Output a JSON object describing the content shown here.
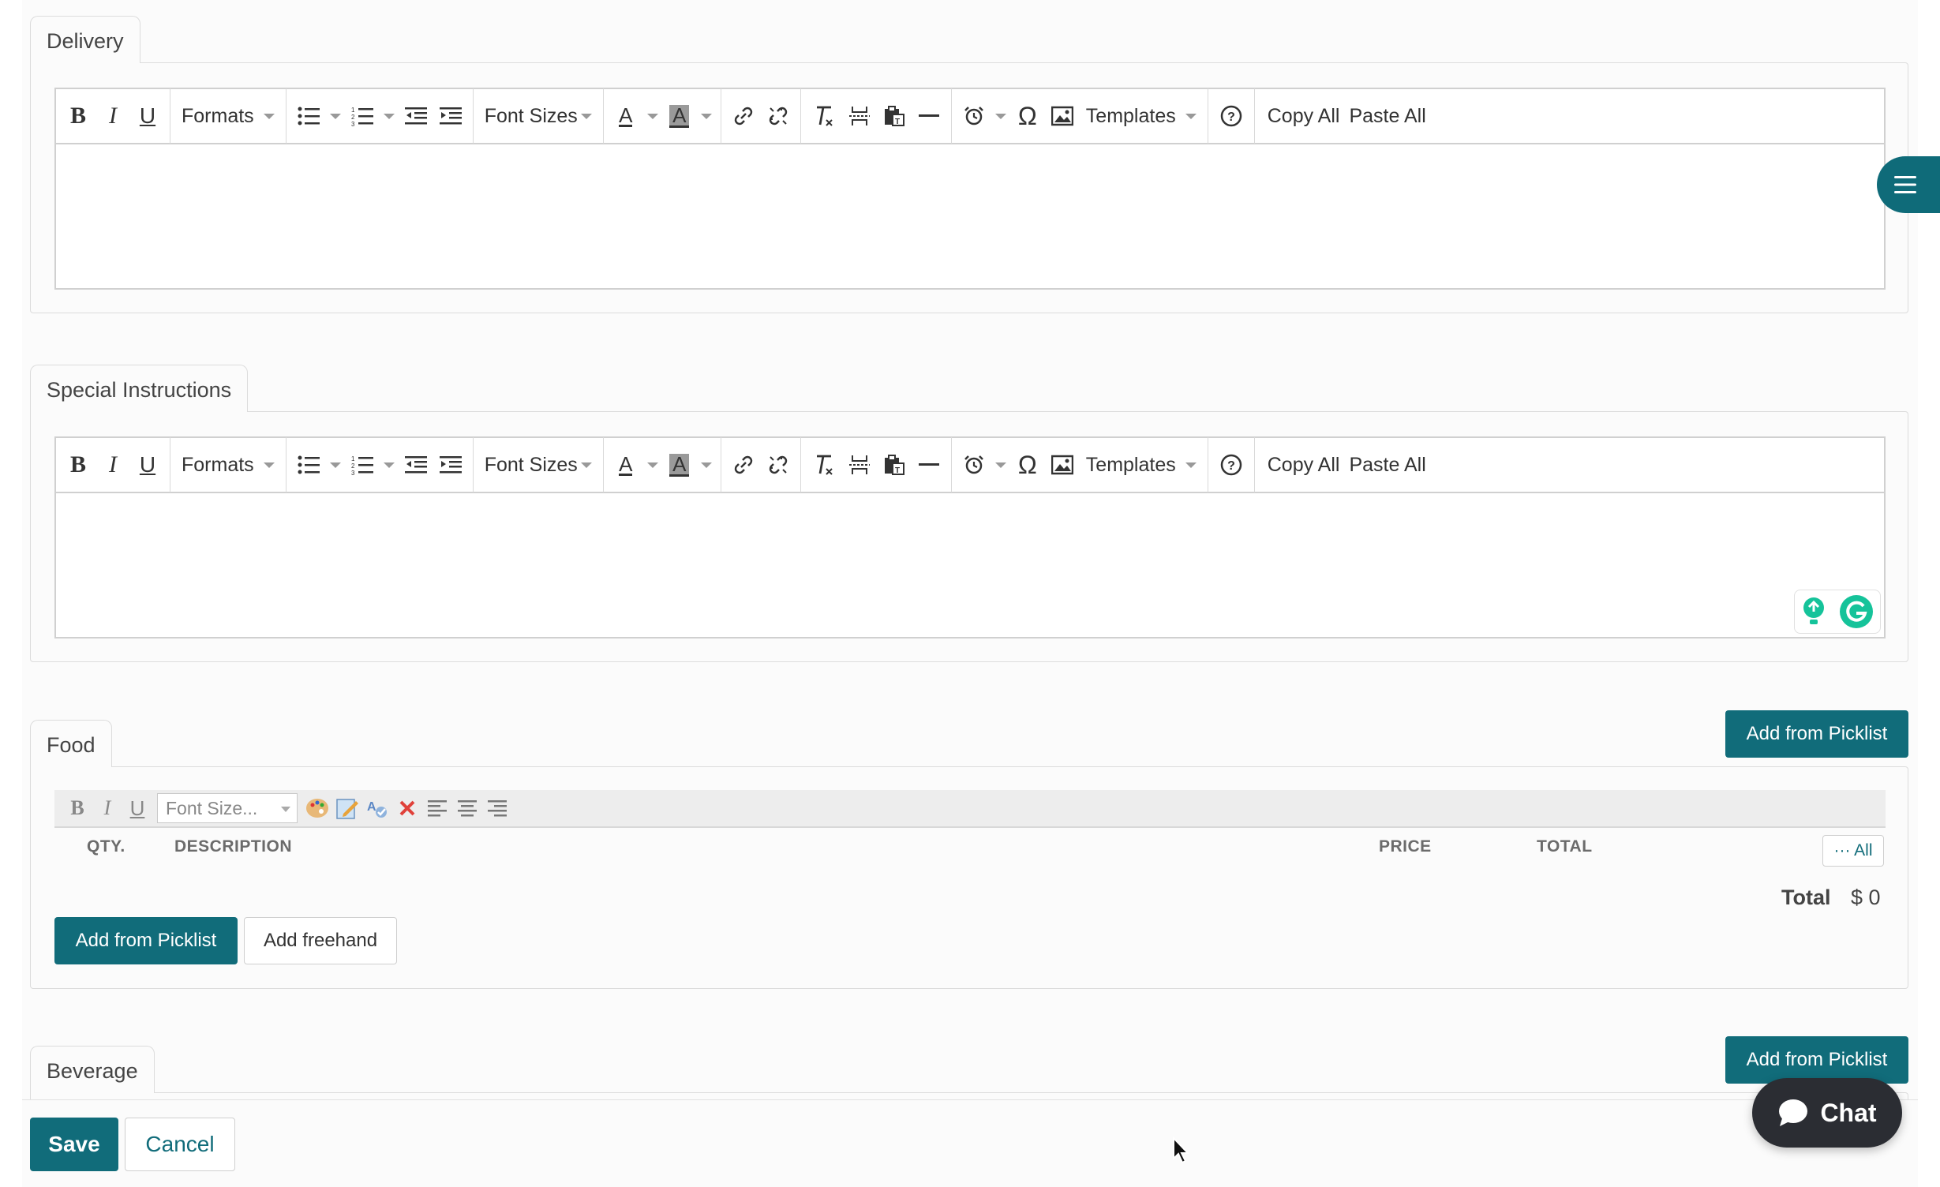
{
  "sections": {
    "delivery": {
      "title": "Delivery"
    },
    "special": {
      "title": "Special Instructions"
    },
    "food": {
      "title": "Food",
      "add_picklist_label": "Add from Picklist",
      "font_size_placeholder": "Font Size...",
      "columns": {
        "qty": "QTY.",
        "description": "DESCRIPTION",
        "price": "PRICE",
        "total": "TOTAL"
      },
      "all_label": "··· All",
      "total_label": "Total",
      "total_value": "$ 0",
      "add_from_picklist": "Add from Picklist",
      "add_freehand": "Add freehand"
    },
    "beverage": {
      "title": "Beverage",
      "add_picklist_label": "Add from Picklist"
    }
  },
  "toolbar": {
    "formats": "Formats",
    "font_sizes": "Font Sizes",
    "templates": "Templates",
    "copy_all": "Copy All",
    "paste_all": "Paste All",
    "text_color_letter": "A",
    "bg_color_letter": "A",
    "bold": "B",
    "italic": "I",
    "underline": "U",
    "omega": "Ω"
  },
  "mini_toolbar": {
    "bold": "B",
    "italic": "I",
    "underline": "U"
  },
  "footer": {
    "save": "Save",
    "cancel": "Cancel"
  },
  "chat": {
    "label": "Chat"
  },
  "colors": {
    "primary": "#116c7a",
    "chat_bg": "#2b2d33"
  }
}
